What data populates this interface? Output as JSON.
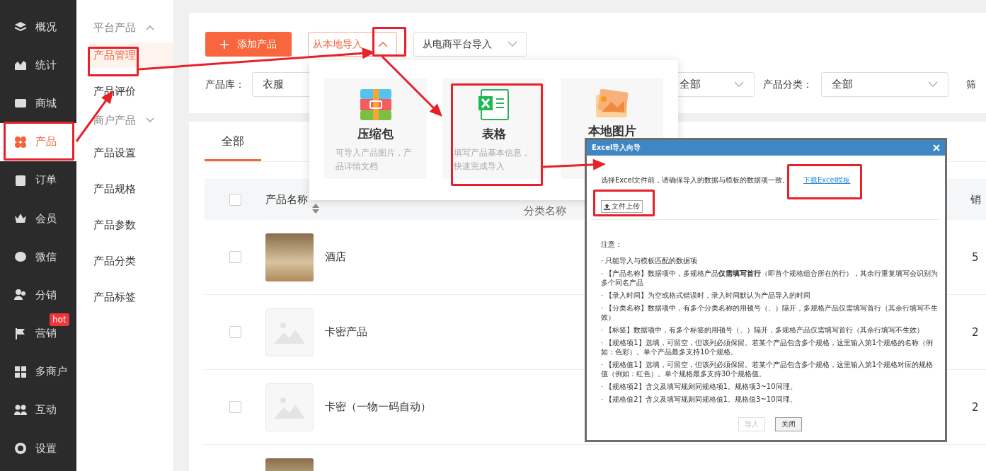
{
  "sidebar": {
    "items": [
      {
        "label": "概况",
        "selected": false
      },
      {
        "label": "统计",
        "selected": false
      },
      {
        "label": "商城",
        "selected": false
      },
      {
        "label": "产品",
        "selected": true
      },
      {
        "label": "订单",
        "selected": false
      },
      {
        "label": "会员",
        "selected": false
      },
      {
        "label": "微信",
        "selected": false
      },
      {
        "label": "分销",
        "selected": false
      },
      {
        "label": "营销",
        "selected": false,
        "badge": "hot"
      },
      {
        "label": "多商户",
        "selected": false
      },
      {
        "label": "互动",
        "selected": false
      },
      {
        "label": "设置",
        "selected": false
      }
    ]
  },
  "subnav": {
    "items": [
      {
        "kind": "group",
        "label": "平台产品",
        "expanded": true,
        "children": [
          {
            "label": "产品管理",
            "selected": true
          },
          {
            "label": "产品评价",
            "selected": false
          }
        ]
      },
      {
        "kind": "group",
        "label": "商户产品",
        "expanded": false
      },
      {
        "kind": "link",
        "label": "产品设置",
        "selected": false
      },
      {
        "kind": "link",
        "label": "产品规格",
        "selected": false
      },
      {
        "kind": "link",
        "label": "产品参数",
        "selected": false
      },
      {
        "kind": "link",
        "label": "产品分类",
        "selected": false
      },
      {
        "kind": "link",
        "label": "产品标签",
        "selected": false
      }
    ]
  },
  "toolbar": {
    "add_button": "添加产品",
    "import_local": {
      "label": "从本地导入",
      "expanded": true
    },
    "import_platform": {
      "label": "从电商平台导入"
    }
  },
  "filters": {
    "library": {
      "label": "产品库：",
      "value": "衣服"
    },
    "status": {
      "value": "全部"
    },
    "category": {
      "label": "产品分类：",
      "value": "全部"
    },
    "trailing_label": "筛"
  },
  "tabs": [
    {
      "label": "全部",
      "selected": true
    }
  ],
  "table": {
    "select_all": false,
    "columns": [
      "产品名称",
      "分类名称",
      "销"
    ],
    "rows": [
      {
        "checked": false,
        "kind": "photo",
        "name": "酒店",
        "column_3": "5"
      },
      {
        "checked": false,
        "kind": "placeholder",
        "name": "卡密产品",
        "column_3": "2"
      },
      {
        "checked": false,
        "kind": "placeholder",
        "name": "卡密（一物一码自动）",
        "column_3": "2"
      },
      {
        "kind": "photo"
      }
    ]
  },
  "import_menu": {
    "options": [
      {
        "kind": "archive",
        "title": "压缩包",
        "description": "可导入产品图片，产品详情文档"
      },
      {
        "kind": "sheet",
        "title": "表格",
        "description": "填写产品基本信息，快速完成导入"
      },
      {
        "kind": "image",
        "title": "本地图片"
      }
    ]
  },
  "dialog": {
    "title": "Excel导入向导",
    "intro": "选择Excel文件前，请确保导入的数据与模板的数据项一致。",
    "download_link": "下载Excel模板",
    "upload_button": "文件上传",
    "notes_title": "注意：",
    "notes": [
      "· 只能导入与模板匹配的数据项",
      "· 【产品名称】数据项中，多规格产品**仅需填写首行**（即首个规格组合所在的行），其余行重复填写会识别为多个同名产品",
      "· 【录入时间】为空或格式错误时，录入时间默认为产品导入的时间",
      "· 【分类名称】数据项中，有多个分类名称的用顿号（、）隔开，多规格产品仅需填写首行（其余行填写不生效）",
      "· 【标签】数据项中，有多个标签的用顿号（、）隔开，多规格产品仅需填写首行（其余行填写不生效）",
      "· 【规格项1】选填，可留空，但该列必须保留。若某个产品包含多个规格，这里输入第1个规格的名称（例如：色彩）。单个产品最多支持10个规格。",
      "· 【规格值1】选填，可留空，但该列必须保留。若某个产品包含多个规格，这里输入第1个规格对应的规格值（例如：红色）。单个规格最多支持30个规格值。",
      "· 【规格项2】含义及填写规则同规格项1。规格项3~10同理。",
      "· 【规格值2】含义及填写规则同规格值1。规格值3~10同理。"
    ],
    "buttons": [
      {
        "label": "导入",
        "disabled": true
      },
      {
        "label": "关闭",
        "disabled": false
      }
    ]
  }
}
